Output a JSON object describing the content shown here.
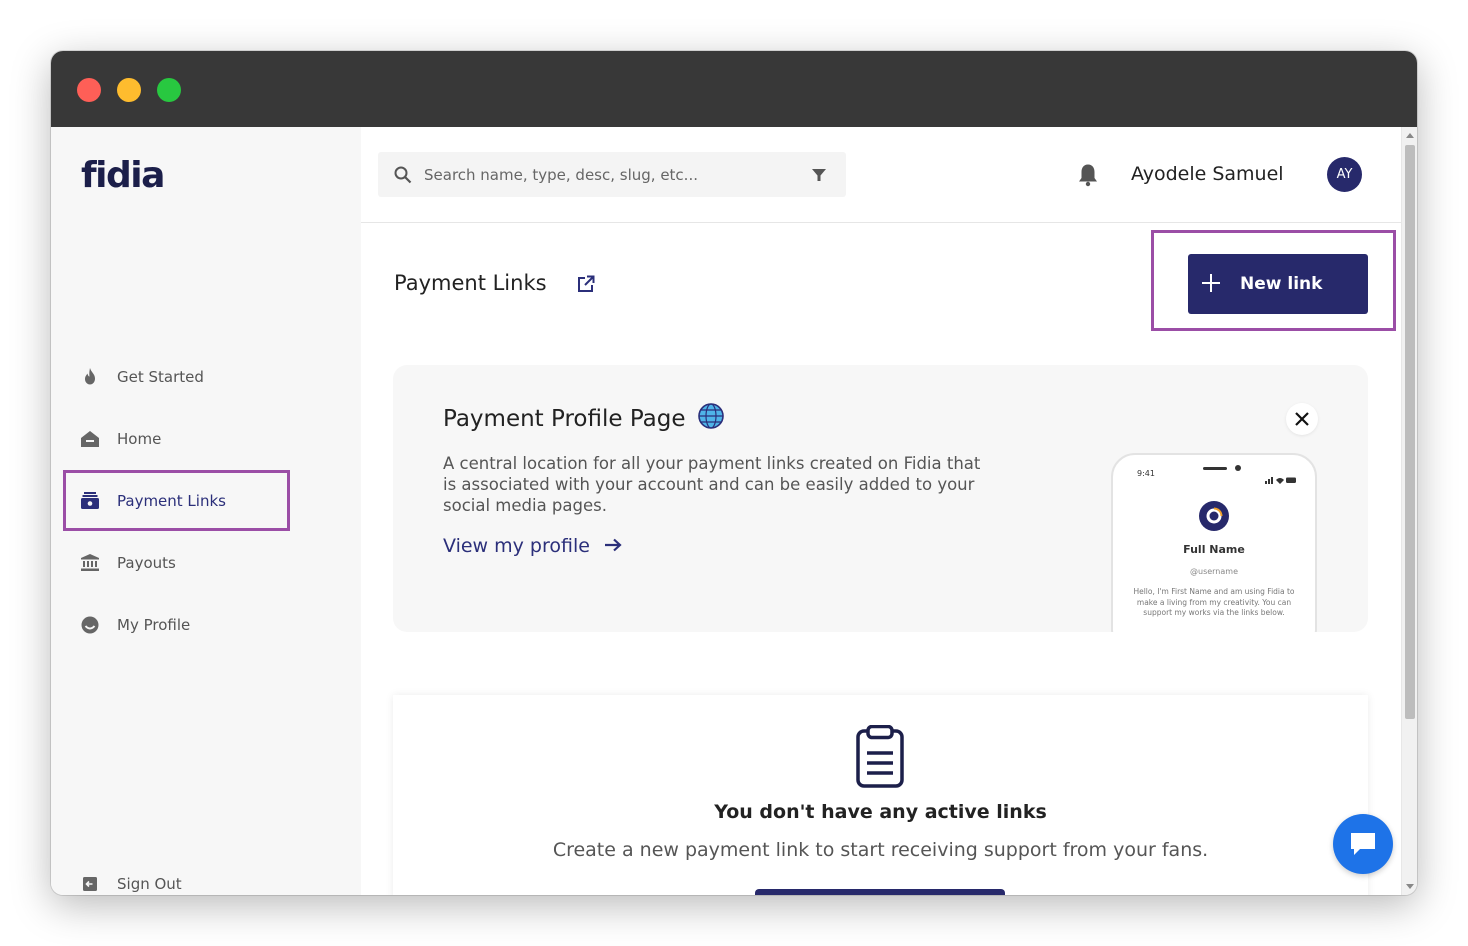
{
  "window": {
    "controls": [
      "close",
      "minimize",
      "maximize"
    ]
  },
  "sidebar": {
    "logo": "fidia",
    "items": [
      {
        "label": "Get Started",
        "icon": "flame-icon"
      },
      {
        "label": "Home",
        "icon": "home-icon"
      },
      {
        "label": "Payment Links",
        "icon": "payment-link-icon",
        "active": true
      },
      {
        "label": "Payouts",
        "icon": "bank-icon"
      },
      {
        "label": "My Profile",
        "icon": "profile-icon"
      }
    ],
    "sign_out": {
      "label": "Sign Out",
      "icon": "sign-out-icon"
    }
  },
  "header": {
    "search_placeholder": "Search name, type, desc, slug, etc...",
    "user_name": "Ayodele Samuel",
    "avatar_initials": "AY"
  },
  "page": {
    "title": "Payment Links",
    "new_link_label": "New link"
  },
  "profile_card": {
    "title": "Payment Profile Page",
    "description": "A central location for all your payment links created on Fidia that is associated with your account and can be easily added to your social media pages.",
    "link_label": "View my profile",
    "phone": {
      "time": "9:41",
      "name": "Full Name",
      "handle": "@username",
      "bio": "Hello, I'm First Name and am using Fidia to make a living from my creativity. You can support my works via the links below."
    }
  },
  "empty_state": {
    "title": "You don't have any active links",
    "subtitle": "Create a new payment link to start receiving support from your fans."
  },
  "colors": {
    "brand": "#27296b",
    "highlight": "#9b4ea6",
    "chat": "#1e73e8"
  }
}
